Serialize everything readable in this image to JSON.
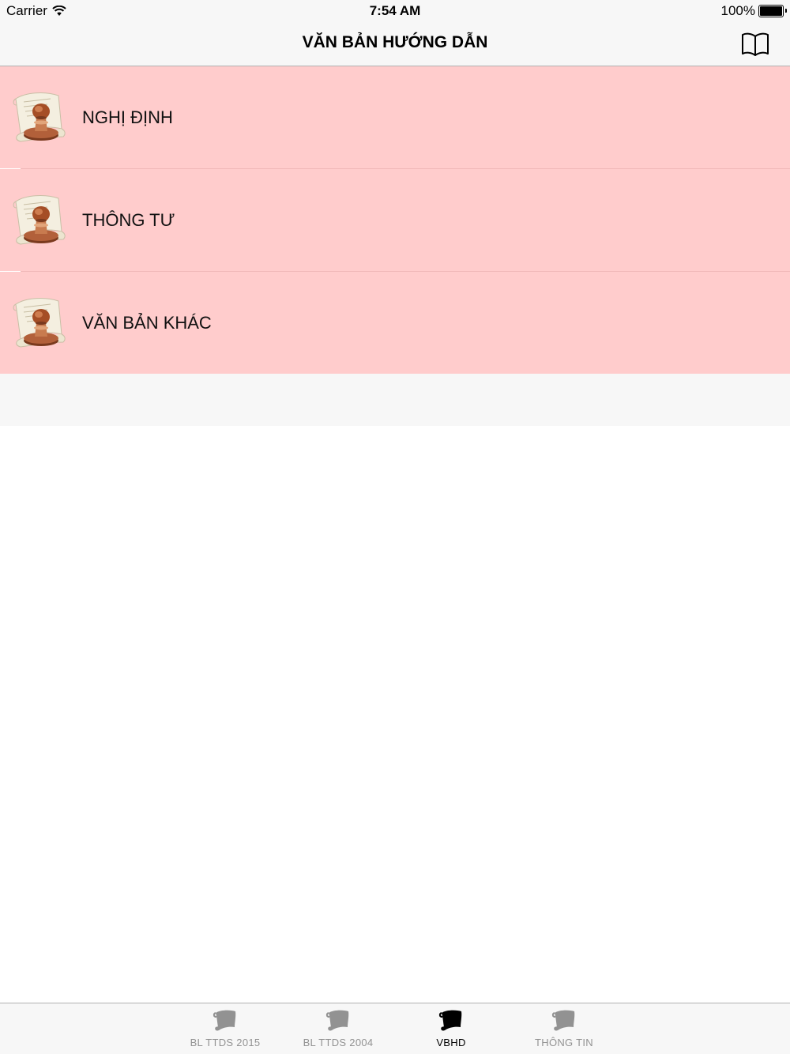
{
  "status_bar": {
    "carrier": "Carrier",
    "time": "7:54 AM",
    "battery": "100%",
    "battery_level": 1.0
  },
  "nav": {
    "title": "VĂN BẢN HƯỚNG DẪN",
    "right_icon": "book-icon"
  },
  "list": {
    "items": [
      {
        "label": "NGHỊ ĐỊNH",
        "icon": "stamp-scroll-icon"
      },
      {
        "label": "THÔNG TƯ",
        "icon": "stamp-scroll-icon"
      },
      {
        "label": "VĂN BẢN KHÁC",
        "icon": "stamp-scroll-icon"
      }
    ]
  },
  "tabs": [
    {
      "label": "BL TTDS 2015",
      "icon": "scroll-icon",
      "active": false
    },
    {
      "label": "BL TTDS 2004",
      "icon": "scroll-icon",
      "active": false
    },
    {
      "label": "VBHD",
      "icon": "scroll-icon",
      "active": true
    },
    {
      "label": "THÔNG TIN",
      "icon": "scroll-icon",
      "active": false
    }
  ],
  "colors": {
    "list_background": "#ffcccc",
    "bar_background": "#f7f7f7",
    "tab_active": "#000000",
    "tab_inactive": "#929292"
  }
}
